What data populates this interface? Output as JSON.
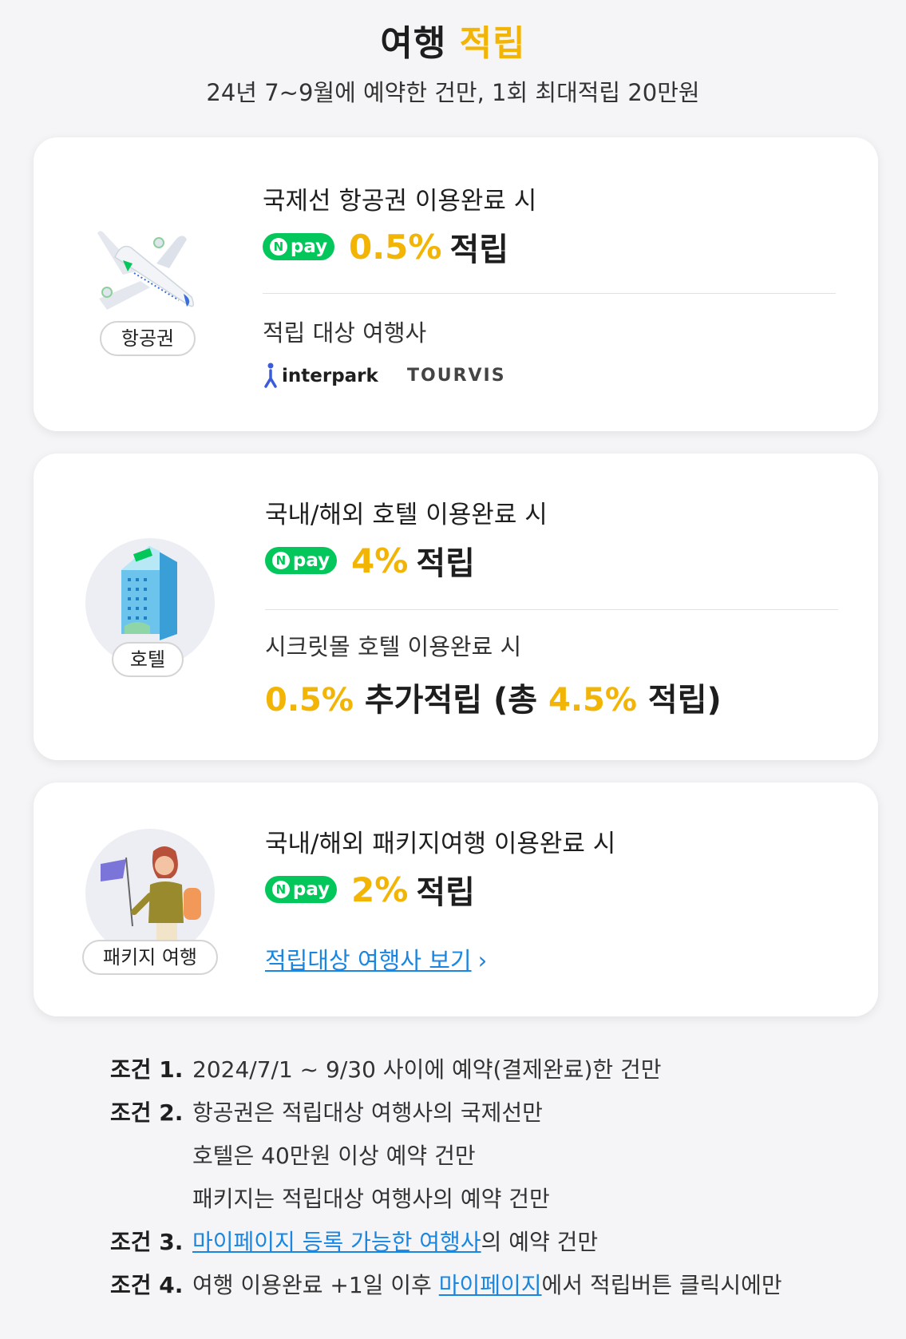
{
  "header": {
    "title_main": "여행",
    "title_accent": "적립",
    "subtitle": "24년 7~9월에 예약한 건만, 1회 최대적립 20만원"
  },
  "colors": {
    "accent": "#f2b405",
    "npay_green": "#03c75a",
    "link": "#1a86e0"
  },
  "npay": {
    "n": "N",
    "pay": "pay"
  },
  "cards": [
    {
      "badge": "항공권",
      "headline": "국제선 항공권 이용완료 시",
      "rate": "0.5%",
      "earn": "적립",
      "partners_label": "적립 대상 여행사",
      "partners": [
        "interpark",
        "TOURVIS"
      ]
    },
    {
      "badge": "호텔",
      "headline": "국내/해외 호텔 이용완료 시",
      "rate": "4%",
      "earn": "적립",
      "extra_label": "시크릿몰 호텔 이용완료 시",
      "extra_rate": "0.5%",
      "extra_text1": "추가적립 (총",
      "extra_total": "4.5%",
      "extra_text2": "적립)"
    },
    {
      "badge": "패키지 여행",
      "headline": "국내/해외 패키지여행 이용완료 시",
      "rate": "2%",
      "earn": "적립",
      "link": "적립대상 여행사 보기"
    }
  ],
  "conditions": [
    {
      "label": "조건 1.",
      "lines": [
        "2024/7/1 ~ 9/30 사이에 예약(결제완료)한 건만"
      ]
    },
    {
      "label": "조건 2.",
      "lines": [
        "항공권은 적립대상 여행사의 국제선만",
        "호텔은 40만원 이상 예약 건만",
        "패키지는 적립대상 여행사의 예약 건만"
      ]
    },
    {
      "label": "조건 3.",
      "link": "마이페이지 등록 가능한 여행사",
      "after": "의 예약 건만"
    },
    {
      "label": "조건 4.",
      "before": "여행 이용완료 +1일 이후 ",
      "link": "마이페이지",
      "after": "에서 적립버튼 클릭시에만"
    }
  ]
}
